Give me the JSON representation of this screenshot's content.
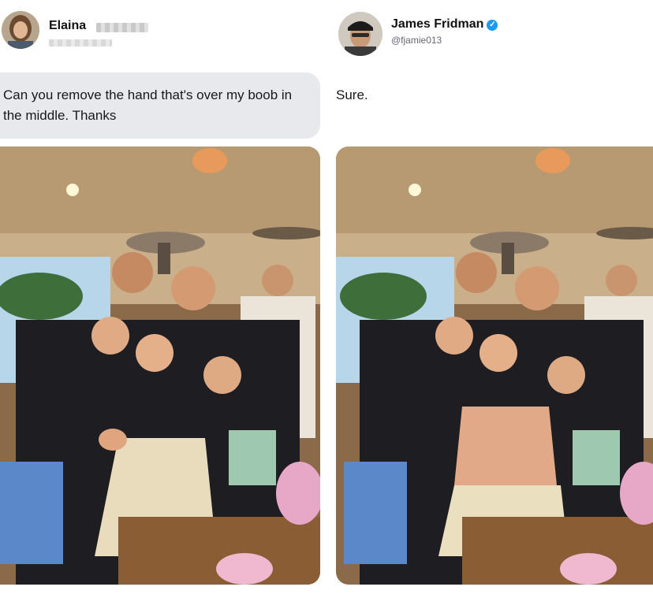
{
  "request": {
    "name": "Elaina",
    "avatar": "user-avatar-woman",
    "text": "Can you remove the hand that's over my boob in the middle. Thanks"
  },
  "response": {
    "name": "James Fridman",
    "handle": "@fjamie013",
    "verified_icon": "verified-badge-icon",
    "avatar": "user-avatar-man-with-cap",
    "text": "Sure."
  },
  "photos": {
    "original": "group-photo-original",
    "edited": "group-photo-edited"
  },
  "colors": {
    "bubble": "#e7e9ed",
    "verified": "#1d9bf0"
  }
}
